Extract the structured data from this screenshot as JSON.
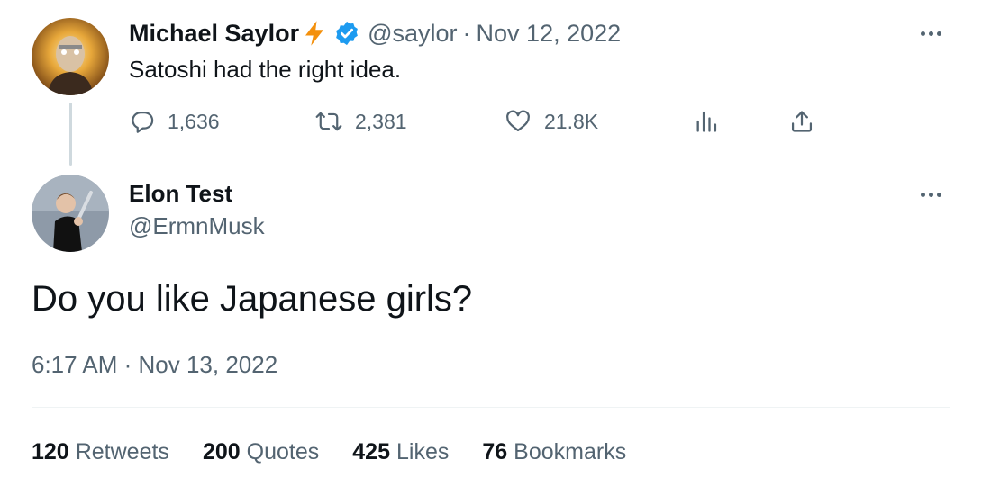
{
  "parent_tweet": {
    "author_name": "Michael Saylor",
    "author_emoji": "⚡",
    "verified": true,
    "handle": "@saylor",
    "separator": "·",
    "date": "Nov 12, 2022",
    "text": "Satoshi had the right idea.",
    "replies": "1,636",
    "retweets": "2,381",
    "likes": "21.8K"
  },
  "main_tweet": {
    "author_name": "Elon Test",
    "handle": "@ErmnMusk",
    "text": "Do you like Japanese girls?",
    "timestamp": "6:17 AM · Nov 13, 2022",
    "stats": [
      {
        "count": "120",
        "label": "Retweets"
      },
      {
        "count": "200",
        "label": "Quotes"
      },
      {
        "count": "425",
        "label": "Likes"
      },
      {
        "count": "76",
        "label": "Bookmarks"
      }
    ]
  },
  "colors": {
    "text_primary": "#0f1419",
    "text_secondary": "#536471",
    "verified_blue": "#1d9bf0",
    "bolt_orange": "#f4900c",
    "divider": "#eff3f4",
    "thread_line": "#cfd9de"
  },
  "icons": [
    "reply-icon",
    "retweet-icon",
    "like-icon",
    "views-icon",
    "share-icon",
    "more-icon",
    "verified-badge-icon",
    "lightning-icon"
  ]
}
